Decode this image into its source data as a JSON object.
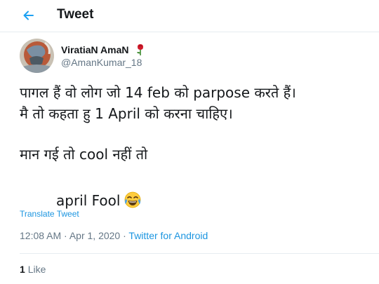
{
  "header": {
    "title": "Tweet"
  },
  "author": {
    "display_name": "ViratiaN AmaN",
    "handle": "@AmanKumar_18"
  },
  "tweet": {
    "lines": [
      "पागल हैं वो लोग जो 14 feb को parpose करते हैं।",
      "मै तो कहता हु 1 April को करना चाहिए।",
      "मान गई तो cool नहीं तो",
      "april Fool"
    ]
  },
  "translate_label": "Translate Tweet",
  "meta": {
    "time": "12:08 AM",
    "separator": " · ",
    "date": "Apr 1, 2020",
    "source": "Twitter for Android"
  },
  "likes": {
    "count": "1",
    "label": "Like"
  },
  "icons": {
    "back": "back-arrow-icon",
    "rose": "rose-icon",
    "laugh": "face-with-tears-of-joy-icon"
  },
  "colors": {
    "accent": "#1b95e0",
    "secondary_text": "#657786"
  }
}
